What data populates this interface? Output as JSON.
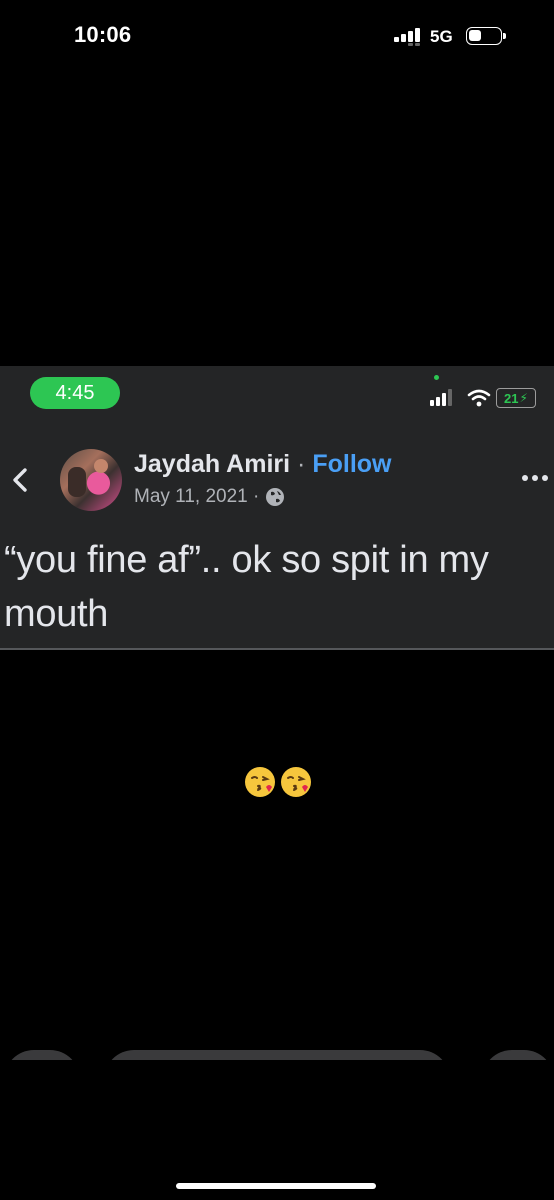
{
  "outer_status": {
    "time": "10:06",
    "network": "5G"
  },
  "inner_status": {
    "time": "4:45",
    "battery": "21"
  },
  "post": {
    "author": "Jaydah Amiri",
    "separator": "·",
    "follow_label": "Follow",
    "date": "May 11, 2021 ·",
    "text": "“you fine af”.. ok so spit in my mouth",
    "privacy_icon": "globe-icon"
  },
  "caption": {
    "emojis": [
      "face-blowing-a-kiss",
      "face-blowing-a-kiss"
    ]
  },
  "colors": {
    "follow": "#4a9ff5",
    "time_pill": "#2dc653",
    "panel_bg": "#242526"
  }
}
